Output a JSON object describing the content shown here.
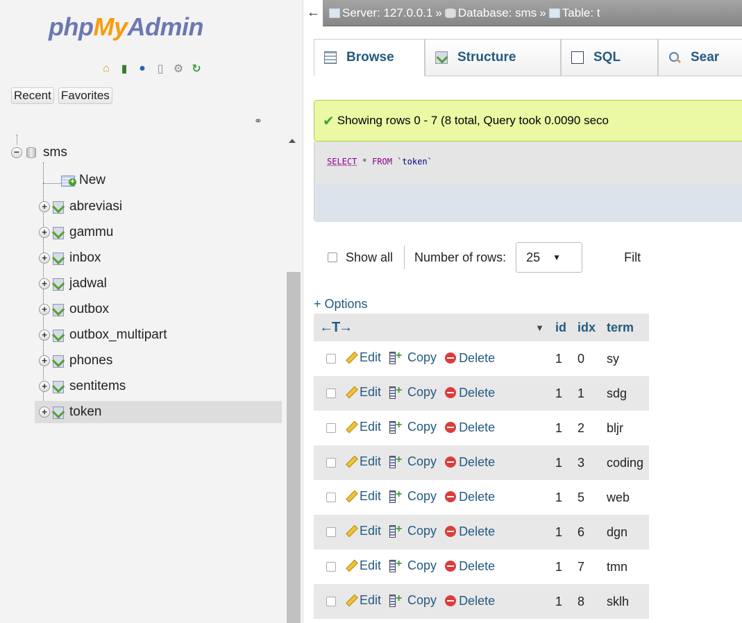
{
  "logo": {
    "php": "php",
    "my": "My",
    "admin": "Admin"
  },
  "nav_icons": [
    "home-icon",
    "exit-icon",
    "help-icon",
    "docs-icon",
    "settings-icon",
    "reload-icon"
  ],
  "nav_buttons": {
    "recent": "Recent",
    "favorites": "Favorites"
  },
  "tree": {
    "database": "sms",
    "new_label": "New",
    "tables": [
      "abreviasi",
      "gammu",
      "inbox",
      "jadwal",
      "outbox",
      "outbox_multipart",
      "phones",
      "sentitems",
      "token"
    ],
    "active_table": "token"
  },
  "breadcrumb": {
    "server": "Server: 127.0.0.1",
    "database": "Database: sms",
    "table": "Table: t",
    "separator": "»"
  },
  "tabs": {
    "browse": "Browse",
    "structure": "Structure",
    "sql": "SQL",
    "search": "Sear"
  },
  "message": {
    "text": "Showing rows 0 - 7 (8 total, Query took 0.0090 seco"
  },
  "sql": {
    "select": "SELECT",
    "star": "*",
    "from": "FROM",
    "table": "`token`"
  },
  "controls": {
    "show_all": "Show all",
    "rows_label": "Number of rows:",
    "rows_value": "25",
    "filter_label": "Filt"
  },
  "options_label": "+ Options",
  "table": {
    "columns": [
      "id",
      "idx",
      "term"
    ],
    "action_labels": {
      "edit": "Edit",
      "copy": "Copy",
      "delete": "Delete"
    },
    "rows": [
      {
        "id": "1",
        "idx": "0",
        "term": "sy"
      },
      {
        "id": "1",
        "idx": "1",
        "term": "sdg"
      },
      {
        "id": "1",
        "idx": "2",
        "term": "bljr"
      },
      {
        "id": "1",
        "idx": "3",
        "term": "coding"
      },
      {
        "id": "1",
        "idx": "5",
        "term": "web"
      },
      {
        "id": "1",
        "idx": "6",
        "term": "dgn"
      },
      {
        "id": "1",
        "idx": "7",
        "term": "tmn"
      },
      {
        "id": "1",
        "idx": "8",
        "term": "sklh"
      }
    ]
  },
  "colors": {
    "link": "#235a81",
    "success_bg": "#ebf8a4",
    "success_border": "#a2d246",
    "logo_orange": "#f89c0e",
    "logo_blue": "#6c78af"
  }
}
